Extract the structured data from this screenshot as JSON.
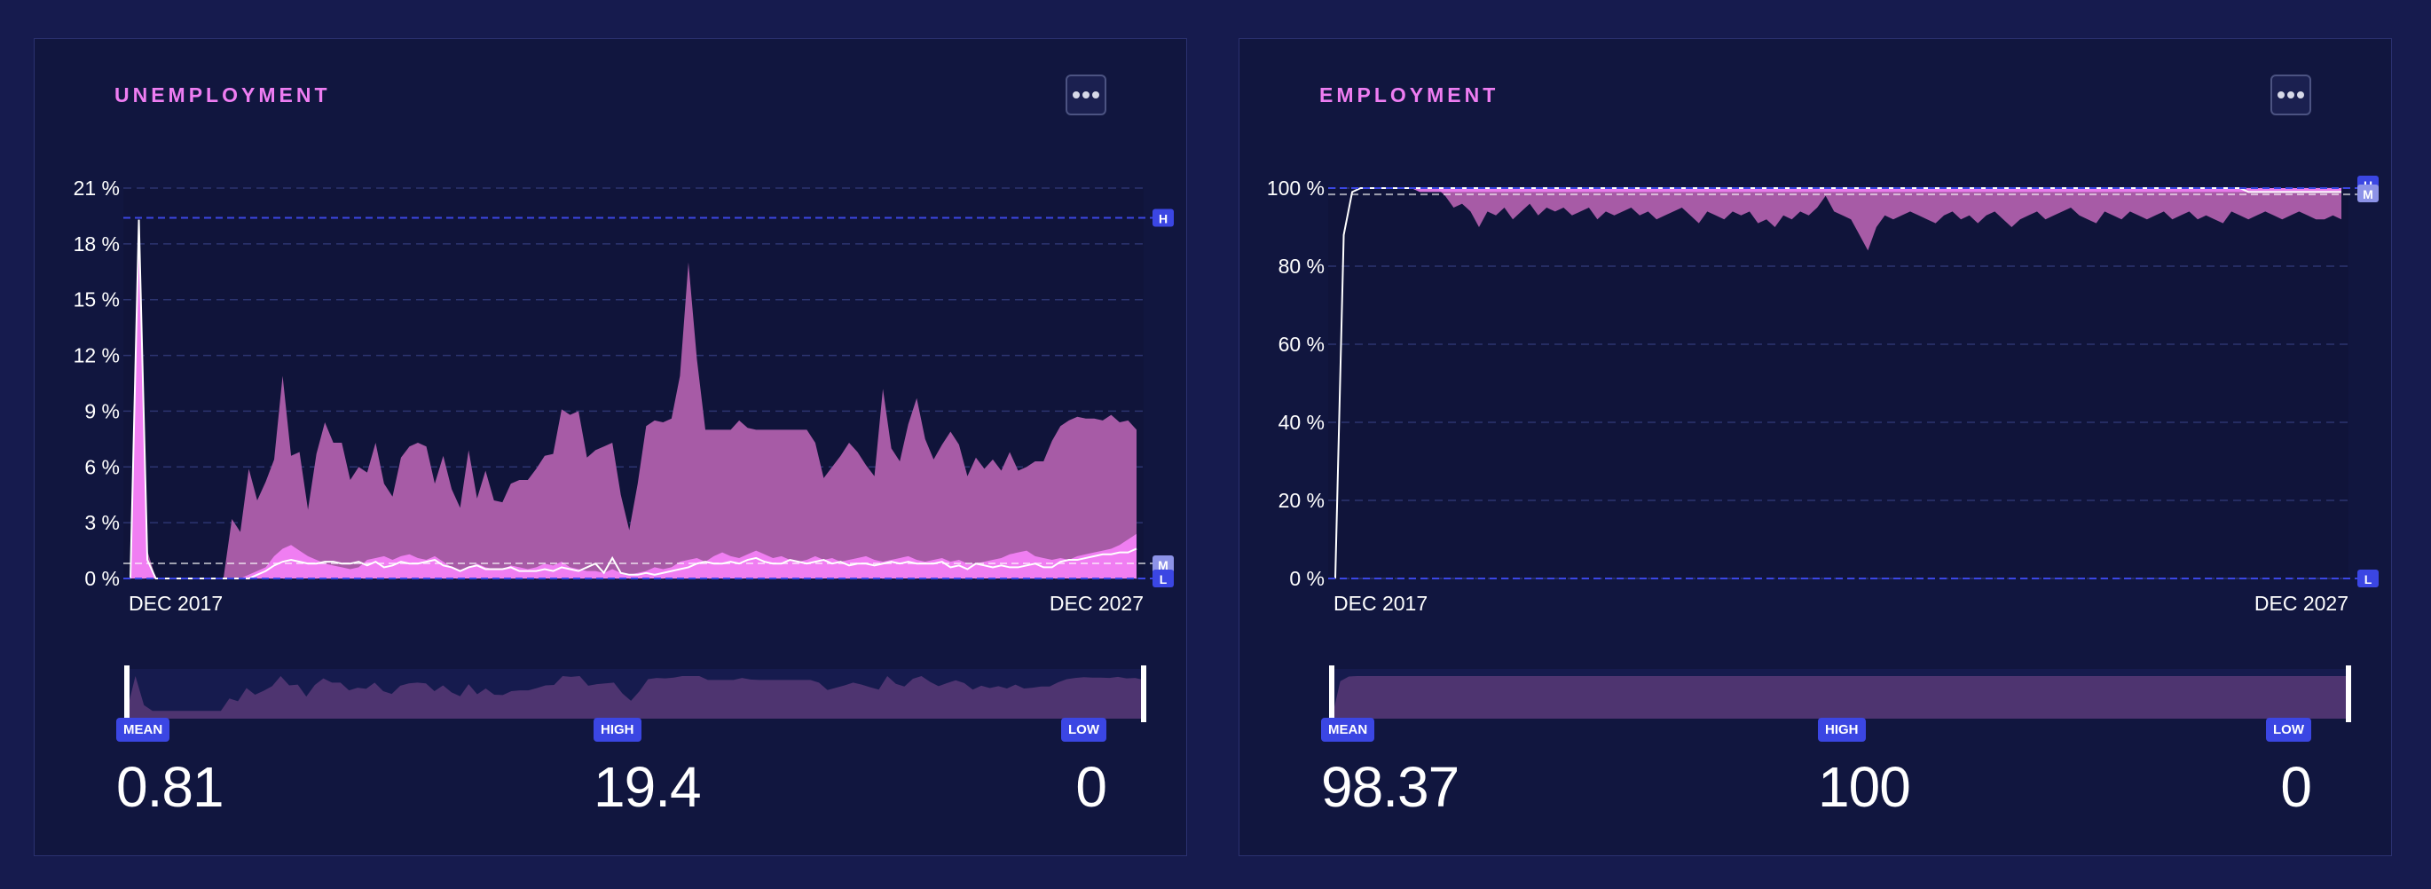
{
  "colors": {
    "accent": "#ee7df2",
    "badge": "#3b46e3",
    "fill": "#a75ba6",
    "fill_bright": "#f07ef2"
  },
  "chart_data": [
    {
      "type": "area",
      "title": "UNEMPLOYMENT",
      "unit": "%",
      "x_start_label": "DEC 2017",
      "x_end_label": "DEC 2027",
      "yticks": [
        "0 %",
        "3 %",
        "6 %",
        "9 %",
        "12 %",
        "15 %",
        "18 %",
        "21 %"
      ],
      "ylim": [
        0,
        21
      ],
      "high": 19.4,
      "mean": 0.81,
      "low": 0,
      "markers": [
        "H",
        "M",
        "L"
      ],
      "stats": [
        {
          "label": "MEAN",
          "value": "0.81"
        },
        {
          "label": "HIGH",
          "value": "19.4"
        },
        {
          "label": "LOW",
          "value": "0"
        }
      ],
      "series": {
        "upper": [
          0,
          19.4,
          1.5,
          0,
          0,
          0,
          0,
          0,
          0,
          0,
          0,
          0,
          3.2,
          2.5,
          5.9,
          4.2,
          5.2,
          6.4,
          10.9,
          6.6,
          6.8,
          3.7,
          6.7,
          8.4,
          7.3,
          7.3,
          5.3,
          6.0,
          5.7,
          7.3,
          5.1,
          4.4,
          6.5,
          7.1,
          7.3,
          7.1,
          5.1,
          6.6,
          4.8,
          3.8,
          6.9,
          4.3,
          5.8,
          4.2,
          4.1,
          5.1,
          5.3,
          5.3,
          5.9,
          6.6,
          6.7,
          9.1,
          8.8,
          9.0,
          6.5,
          6.9,
          7.1,
          7.3,
          4.5,
          2.6,
          5.1,
          8.2,
          8.5,
          8.4,
          8.6,
          10.9,
          17.0,
          11.8,
          8.0,
          8.0,
          8.0,
          8.0,
          8.5,
          8.1,
          8.0,
          8.0,
          8.0,
          8.0,
          8.0,
          8.0,
          8.0,
          7.3,
          5.4,
          6.0,
          6.6,
          7.3,
          6.8,
          6.1,
          5.5,
          10.2,
          7.0,
          6.3,
          8.3,
          9.7,
          7.5,
          6.4,
          7.2,
          7.9,
          7.2,
          5.5,
          6.5,
          5.9,
          6.4,
          5.8,
          6.8,
          5.8,
          6.0,
          6.3,
          6.3,
          7.4,
          8.2,
          8.5,
          8.7,
          8.6,
          8.6,
          8.5,
          8.8,
          8.4,
          8.5,
          8.0
        ],
        "mid": [
          0,
          19.2,
          1.0,
          0,
          0,
          0,
          0,
          0,
          0,
          0,
          0,
          0,
          0,
          0,
          0.2,
          0.4,
          0.6,
          1.2,
          1.6,
          1.8,
          1.5,
          1.2,
          1.0,
          0.8,
          0.7,
          0.6,
          0.5,
          0.6,
          1.0,
          1.1,
          1.2,
          1.0,
          1.2,
          1.3,
          1.1,
          1.0,
          1.2,
          0.9,
          0.6,
          0.4,
          0.6,
          0.8,
          0.6,
          0.5,
          0.5,
          0.7,
          0.6,
          0.5,
          0.6,
          0.8,
          0.7,
          0.9,
          0.6,
          0.5,
          0.4,
          0.4,
          0.3,
          0.5,
          0.3,
          0.2,
          0.3,
          0.4,
          0.6,
          0.5,
          0.6,
          0.9,
          1.0,
          1.1,
          0.9,
          1.2,
          1.4,
          1.2,
          1.1,
          1.3,
          1.5,
          1.3,
          1.1,
          1.2,
          1.0,
          0.9,
          1.0,
          1.2,
          1.0,
          1.1,
          0.9,
          1.0,
          1.1,
          1.2,
          1.0,
          0.9,
          1.0,
          1.1,
          1.2,
          1.0,
          0.9,
          1.0,
          1.1,
          0.9,
          1.0,
          0.8,
          0.8,
          0.9,
          1.0,
          1.1,
          1.3,
          1.4,
          1.5,
          1.2,
          1.1,
          1.0,
          1.1,
          1.0,
          1.2,
          1.3,
          1.4,
          1.5,
          1.6,
          1.8,
          2.1,
          2.4
        ],
        "line": [
          0,
          19.3,
          1.0,
          0,
          0,
          0,
          0,
          0,
          0,
          0,
          0,
          0,
          0,
          0,
          0,
          0.2,
          0.4,
          0.7,
          0.9,
          1.0,
          0.9,
          0.8,
          0.8,
          0.9,
          0.9,
          0.8,
          0.8,
          0.9,
          0.7,
          0.9,
          0.6,
          0.7,
          0.9,
          0.8,
          0.8,
          0.9,
          1.0,
          0.7,
          0.6,
          0.4,
          0.6,
          0.7,
          0.5,
          0.5,
          0.5,
          0.6,
          0.4,
          0.4,
          0.4,
          0.5,
          0.4,
          0.6,
          0.5,
          0.4,
          0.6,
          0.8,
          0.3,
          1.1,
          0.3,
          0.2,
          0.2,
          0.3,
          0.2,
          0.3,
          0.4,
          0.5,
          0.6,
          0.8,
          0.9,
          0.8,
          0.8,
          0.9,
          0.8,
          1.0,
          1.1,
          0.9,
          0.8,
          0.8,
          1.0,
          0.9,
          0.8,
          0.9,
          1.0,
          0.8,
          0.9,
          0.7,
          0.8,
          0.8,
          0.7,
          0.8,
          0.9,
          0.8,
          0.9,
          0.8,
          0.8,
          0.8,
          0.9,
          0.6,
          0.7,
          0.5,
          0.8,
          0.7,
          0.6,
          0.7,
          0.6,
          0.6,
          0.7,
          0.8,
          0.6,
          0.6,
          0.9,
          1.0,
          1.0,
          1.1,
          1.2,
          1.3,
          1.3,
          1.4,
          1.4,
          1.6
        ]
      }
    },
    {
      "type": "area",
      "title": "EMPLOYMENT",
      "unit": "%",
      "x_start_label": "DEC 2017",
      "x_end_label": "DEC 2027",
      "yticks": [
        "0 %",
        "20 %",
        "40 %",
        "60 %",
        "80 %",
        "100 %"
      ],
      "ylim": [
        0,
        100
      ],
      "high": 100,
      "mean": 98.37,
      "low": 0,
      "markers": [
        "H",
        "M",
        "L"
      ],
      "stats": [
        {
          "label": "MEAN",
          "value": "98.37"
        },
        {
          "label": "HIGH",
          "value": "100"
        },
        {
          "label": "LOW",
          "value": "0"
        }
      ],
      "series": {
        "upper": [
          0,
          88,
          99,
          100,
          100,
          100,
          100,
          100,
          100,
          100,
          100,
          100,
          100,
          100,
          100,
          100,
          100,
          100,
          100,
          100,
          100,
          100,
          100,
          100,
          100,
          100,
          100,
          100,
          100,
          100,
          100,
          100,
          100,
          100,
          100,
          100,
          100,
          100,
          100,
          100,
          100,
          100,
          100,
          100,
          100,
          100,
          100,
          100,
          100,
          100,
          100,
          100,
          100,
          100,
          100,
          100,
          100,
          100,
          100,
          100,
          100,
          100,
          100,
          100,
          100,
          100,
          100,
          100,
          100,
          100,
          100,
          100,
          100,
          100,
          100,
          100,
          100,
          100,
          100,
          100,
          100,
          100,
          100,
          100,
          100,
          100,
          100,
          100,
          100,
          100,
          100,
          100,
          100,
          100,
          100,
          100,
          100,
          100,
          100,
          100,
          100,
          100,
          100,
          100,
          100,
          100,
          100,
          100,
          100,
          100,
          100,
          100,
          100,
          100,
          100,
          100,
          100,
          100,
          100,
          100
        ],
        "lower": [
          0,
          88,
          99,
          100,
          100,
          100,
          100,
          100,
          100,
          100,
          100,
          100,
          100,
          98,
          95,
          96,
          94,
          90,
          94,
          93,
          95,
          92,
          94,
          96,
          93,
          95,
          94,
          95,
          93,
          94,
          95,
          92,
          94,
          93,
          94,
          95,
          93,
          94,
          92,
          93,
          94,
          95,
          93,
          91,
          94,
          93,
          92,
          94,
          93,
          94,
          91,
          92,
          90,
          93,
          92,
          94,
          93,
          95,
          98,
          94,
          93,
          92,
          88,
          84,
          90,
          93,
          92,
          93,
          94,
          93,
          92,
          91,
          93,
          94,
          92,
          93,
          91,
          93,
          94,
          92,
          90,
          92,
          93,
          94,
          92,
          93,
          94,
          95,
          93,
          92,
          91,
          94,
          93,
          92,
          94,
          93,
          92,
          93,
          94,
          92,
          93,
          94,
          92,
          93,
          92,
          91,
          94,
          93,
          92,
          93,
          94,
          93,
          92,
          93,
          94,
          93,
          92,
          92,
          93,
          92
        ],
        "mid": [
          0,
          88,
          99,
          100,
          100,
          100,
          100,
          100,
          100,
          100,
          99,
          99,
          99,
          99,
          99,
          99,
          99,
          99,
          99,
          99,
          99,
          99,
          99,
          99,
          99,
          99,
          99,
          99,
          99,
          99,
          99,
          99,
          99,
          99,
          99,
          99,
          99,
          99,
          99,
          99,
          99,
          99,
          99,
          99,
          99,
          99,
          99,
          99,
          99,
          99,
          99,
          99,
          99,
          99,
          99,
          99,
          99,
          99,
          99,
          99,
          99,
          99,
          99,
          99,
          99,
          99,
          99,
          99,
          99,
          99,
          99,
          99,
          99,
          99,
          99,
          99,
          99,
          99,
          99,
          99,
          99,
          99,
          99,
          99,
          99,
          99,
          99,
          99,
          99,
          99,
          99,
          99,
          99,
          99,
          99,
          99,
          99,
          99,
          99,
          99,
          99,
          99,
          99,
          99,
          99,
          99,
          99,
          99,
          99,
          99,
          99,
          99,
          99,
          99,
          99,
          99,
          99,
          99,
          99,
          99
        ],
        "line": [
          0,
          88,
          99,
          100,
          100,
          100,
          100,
          100,
          100,
          100,
          100,
          100,
          100,
          100,
          100,
          100,
          100,
          100,
          100,
          100,
          100,
          100,
          100,
          100,
          100,
          100,
          100,
          100,
          100,
          100,
          100,
          100,
          100,
          100,
          100,
          100,
          100,
          100,
          100,
          100,
          100,
          100,
          100,
          100,
          100,
          100,
          100,
          100,
          100,
          100,
          100,
          100,
          100,
          100,
          100,
          100,
          100,
          100,
          100,
          100,
          100,
          100,
          100,
          100,
          100,
          100,
          100,
          100,
          100,
          100,
          100,
          100,
          100,
          100,
          100,
          100,
          100,
          100,
          100,
          100,
          100,
          100,
          100,
          100,
          100,
          100,
          100,
          100,
          100,
          100,
          100,
          100,
          100,
          100,
          100,
          100,
          100,
          100,
          100,
          100,
          100,
          100,
          100,
          100,
          100,
          100,
          100,
          100,
          99,
          99,
          99,
          99,
          99,
          99,
          99,
          99,
          99,
          99,
          99,
          99
        ]
      }
    }
  ]
}
